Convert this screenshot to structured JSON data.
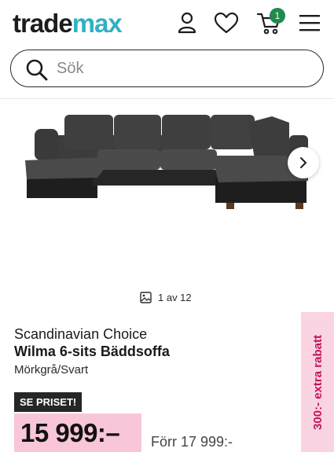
{
  "header": {
    "logo_part1": "trade",
    "logo_part2": "max",
    "icons": [
      "user-icon",
      "heart-icon",
      "cart-icon",
      "menu-icon"
    ],
    "cart_count": "1",
    "colors": {
      "logo_accent": "#2fb1c1",
      "cart_badge": "#1f8a4c"
    }
  },
  "search": {
    "placeholder": "Sök",
    "value": ""
  },
  "gallery": {
    "image": "Grey corner sofa",
    "current": "1",
    "separator": "av",
    "total": "12",
    "counter_text": "1 av 12",
    "next_icon": "chevron-right-icon"
  },
  "product": {
    "brand": "Scandinavian Choice",
    "title": "Wilma 6-sits Bäddsoffa",
    "variant": "Mörkgrå/Svart",
    "price_badge": "SE PRISET!",
    "price": "15 999:–",
    "old_price": "Förr 17 999:-",
    "colors": {
      "price_highlight": "#f8c6d8",
      "badge_bg": "#262626"
    }
  },
  "promo": {
    "text": "300:- extra rabatt",
    "colors": {
      "bg": "#fad4e2",
      "text": "#c4145c"
    }
  }
}
